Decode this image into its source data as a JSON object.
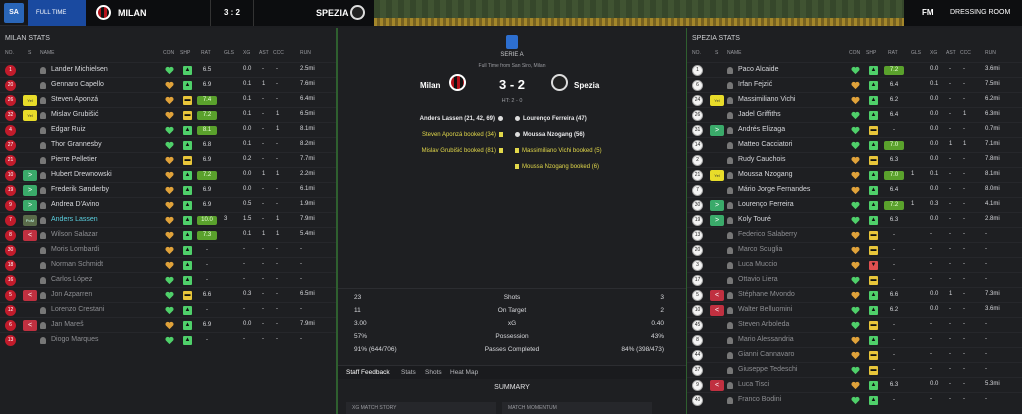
{
  "topbar": {
    "logo": "SA",
    "fulltime": "FULL TIME",
    "home": "MILAN",
    "score": "3 : 2",
    "away": "SPEZIA",
    "fm": "FM",
    "dressing": "DRESSING ROOM",
    "colors": {
      "accent": "#1a4aa0",
      "home": "#b5121b"
    }
  },
  "left": {
    "title": "MILAN STATS",
    "headers": [
      "NO.",
      "S",
      "NAME",
      "CON",
      "SHP",
      "RAT",
      "GLS",
      "XG",
      "AST",
      "CCC",
      "RUN"
    ],
    "players": [
      {
        "no": "1",
        "sub": "",
        "name": "Lander Michielsen",
        "con": "green",
        "shp": "up",
        "rat": "6.5",
        "gls": "",
        "xg": "0.0",
        "ast": "-",
        "ccc": "-",
        "run": "2.5mi",
        "good": false,
        "state": ""
      },
      {
        "no": "20",
        "sub": "",
        "name": "Gennaro Capello",
        "con": "orange",
        "shp": "up",
        "rat": "6.9",
        "gls": "",
        "xg": "0.1",
        "ast": "1",
        "ccc": "-",
        "run": "7.6mi",
        "good": false,
        "state": ""
      },
      {
        "no": "26",
        "sub": "yel",
        "sub_label": "Yel",
        "name": "Steven Aponzá",
        "con": "orange",
        "shp": "mid",
        "rat": "7.4",
        "gls": "",
        "xg": "0.1",
        "ast": "-",
        "ccc": "-",
        "run": "6.4mi",
        "good": true,
        "state": ""
      },
      {
        "no": "32",
        "sub": "yel",
        "sub_label": "Yel",
        "name": "Mislav Grubišić",
        "con": "orange",
        "shp": "mid",
        "rat": "7.2",
        "gls": "",
        "xg": "0.1",
        "ast": "-",
        "ccc": "1",
        "run": "6.5mi",
        "good": true,
        "state": ""
      },
      {
        "no": "4",
        "sub": "",
        "name": "Edgar Ruiz",
        "con": "green",
        "shp": "up",
        "rat": "8.1",
        "gls": "",
        "xg": "0.0",
        "ast": "-",
        "ccc": "1",
        "run": "8.1mi",
        "good": true,
        "state": ""
      },
      {
        "no": "27",
        "sub": "",
        "name": "Thor Grannesby",
        "con": "green",
        "shp": "up",
        "rat": "6.8",
        "gls": "",
        "xg": "0.1",
        "ast": "-",
        "ccc": "-",
        "run": "8.2mi",
        "good": false,
        "state": ""
      },
      {
        "no": "21",
        "sub": "",
        "name": "Pierre Pelletier",
        "con": "orange",
        "shp": "mid",
        "rat": "6.9",
        "gls": "",
        "xg": "0.2",
        "ast": "-",
        "ccc": "-",
        "run": "7.7mi",
        "good": false,
        "state": ""
      },
      {
        "no": "10",
        "sub": "in",
        "sub_label": ">",
        "name": "Hubert Drewnowski",
        "con": "orange",
        "shp": "up",
        "rat": "7.2",
        "gls": "",
        "xg": "0.0",
        "ast": "1",
        "ccc": "1",
        "run": "2.2mi",
        "good": true,
        "state": ""
      },
      {
        "no": "19",
        "sub": "in",
        "sub_label": ">",
        "name": "Frederik Sønderby",
        "con": "orange",
        "shp": "up",
        "rat": "6.9",
        "gls": "",
        "xg": "0.0",
        "ast": "-",
        "ccc": "-",
        "run": "6.1mi",
        "good": false,
        "state": ""
      },
      {
        "no": "9",
        "sub": "in",
        "sub_label": ">",
        "name": "Andrea D'Avino",
        "con": "orange",
        "shp": "up",
        "rat": "6.9",
        "gls": "",
        "xg": "0.5",
        "ast": "-",
        "ccc": "-",
        "run": "1.9mi",
        "good": false,
        "state": ""
      },
      {
        "no": "7",
        "sub": "pom",
        "sub_label": "PoM",
        "name": "Anders Lassen",
        "con": "orange",
        "shp": "up",
        "rat": "10.0",
        "gls": "3",
        "xg": "1.5",
        "ast": "-",
        "ccc": "1",
        "run": "7.9mi",
        "good": true,
        "state": "hl"
      },
      {
        "no": "8",
        "sub": "out",
        "sub_label": "<",
        "name": "Wilson Salazar",
        "con": "orange",
        "shp": "up",
        "rat": "7.3",
        "gls": "",
        "xg": "0.1",
        "ast": "1",
        "ccc": "1",
        "run": "5.4mi",
        "good": true,
        "state": "dim"
      },
      {
        "no": "30",
        "sub": "",
        "name": "Moris Lombardi",
        "con": "orange",
        "shp": "up",
        "rat": "-",
        "gls": "",
        "xg": "-",
        "ast": "-",
        "ccc": "-",
        "run": "-",
        "good": false,
        "state": "dim"
      },
      {
        "no": "18",
        "sub": "",
        "name": "Norman Schmidt",
        "con": "orange",
        "shp": "up",
        "rat": "-",
        "gls": "",
        "xg": "-",
        "ast": "-",
        "ccc": "-",
        "run": "-",
        "good": false,
        "state": "dim"
      },
      {
        "no": "16",
        "sub": "",
        "name": "Carlos López",
        "con": "green",
        "shp": "up",
        "rat": "-",
        "gls": "",
        "xg": "-",
        "ast": "-",
        "ccc": "-",
        "run": "-",
        "good": false,
        "state": "dim"
      },
      {
        "no": "5",
        "sub": "out",
        "sub_label": "<",
        "name": "Jon Azparren",
        "con": "green",
        "shp": "mid",
        "rat": "6.6",
        "gls": "",
        "xg": "0.3",
        "ast": "-",
        "ccc": "-",
        "run": "6.5mi",
        "good": false,
        "state": "dim"
      },
      {
        "no": "12",
        "sub": "",
        "name": "Lorenzo Crestani",
        "con": "green",
        "shp": "up",
        "rat": "-",
        "gls": "",
        "xg": "-",
        "ast": "-",
        "ccc": "-",
        "run": "-",
        "good": false,
        "state": "dim"
      },
      {
        "no": "6",
        "sub": "out",
        "sub_label": "<",
        "name": "Jan Mareš",
        "con": "orange",
        "shp": "up",
        "rat": "6.9",
        "gls": "",
        "xg": "0.0",
        "ast": "-",
        "ccc": "-",
        "run": "7.9mi",
        "good": false,
        "state": "dim"
      },
      {
        "no": "13",
        "sub": "",
        "name": "Diogo Marques",
        "con": "green",
        "shp": "up",
        "rat": "-",
        "gls": "",
        "xg": "-",
        "ast": "-",
        "ccc": "-",
        "run": "-",
        "good": false,
        "state": "dim"
      }
    ]
  },
  "right": {
    "title": "SPEZIA STATS",
    "headers": [
      "NO.",
      "S",
      "NAME",
      "CON",
      "SHP",
      "RAT",
      "GLS",
      "XG",
      "AST",
      "CCC",
      "RUN"
    ],
    "players": [
      {
        "no": "1",
        "sub": "",
        "name": "Paco Alcaide",
        "con": "green",
        "shp": "up",
        "rat": "7.2",
        "gls": "",
        "xg": "0.0",
        "ast": "-",
        "ccc": "-",
        "run": "3.6mi",
        "good": true,
        "state": ""
      },
      {
        "no": "6",
        "sub": "",
        "name": "Irfan Fejzić",
        "con": "orange",
        "shp": "up",
        "rat": "6.4",
        "gls": "",
        "xg": "0.1",
        "ast": "-",
        "ccc": "-",
        "run": "7.5mi",
        "good": false,
        "state": ""
      },
      {
        "no": "24",
        "sub": "yel",
        "sub_label": "Yel",
        "name": "Massimiliano Vichi",
        "con": "orange",
        "shp": "up",
        "rat": "6.2",
        "gls": "",
        "xg": "0.0",
        "ast": "-",
        "ccc": "-",
        "run": "6.2mi",
        "good": false,
        "state": ""
      },
      {
        "no": "26",
        "sub": "",
        "name": "Jadel Griffiths",
        "con": "green",
        "shp": "up",
        "rat": "6.4",
        "gls": "",
        "xg": "0.0",
        "ast": "-",
        "ccc": "1",
        "run": "6.3mi",
        "good": false,
        "state": ""
      },
      {
        "no": "31",
        "sub": "in",
        "sub_label": ">",
        "name": "Andrés Elizaga",
        "con": "green",
        "shp": "mid",
        "rat": "-",
        "gls": "",
        "xg": "0.0",
        "ast": "-",
        "ccc": "-",
        "run": "0.7mi",
        "good": false,
        "state": ""
      },
      {
        "no": "14",
        "sub": "",
        "name": "Matteo Cacciatori",
        "con": "green",
        "shp": "up",
        "rat": "7.0",
        "gls": "",
        "xg": "0.0",
        "ast": "1",
        "ccc": "1",
        "run": "7.1mi",
        "good": true,
        "state": ""
      },
      {
        "no": "2",
        "sub": "",
        "name": "Rudy Cauchois",
        "con": "orange",
        "shp": "mid",
        "rat": "6.3",
        "gls": "",
        "xg": "0.0",
        "ast": "-",
        "ccc": "-",
        "run": "7.8mi",
        "good": false,
        "state": ""
      },
      {
        "no": "21",
        "sub": "yel",
        "sub_label": "Yel",
        "name": "Moussa Nzogang",
        "con": "orange",
        "shp": "up",
        "rat": "7.0",
        "gls": "1",
        "xg": "0.1",
        "ast": "-",
        "ccc": "-",
        "run": "8.1mi",
        "good": true,
        "state": ""
      },
      {
        "no": "7",
        "sub": "",
        "name": "Mário Jorge Fernandes",
        "con": "orange",
        "shp": "up",
        "rat": "6.4",
        "gls": "",
        "xg": "0.0",
        "ast": "-",
        "ccc": "-",
        "run": "8.0mi",
        "good": false,
        "state": ""
      },
      {
        "no": "30",
        "sub": "in",
        "sub_label": ">",
        "name": "Lourenço Ferreira",
        "con": "green",
        "shp": "up",
        "rat": "7.2",
        "gls": "1",
        "xg": "0.3",
        "ast": "-",
        "ccc": "-",
        "run": "4.1mi",
        "good": true,
        "state": ""
      },
      {
        "no": "19",
        "sub": "in",
        "sub_label": ">",
        "name": "Koly Touré",
        "con": "green",
        "shp": "up",
        "rat": "6.3",
        "gls": "",
        "xg": "0.0",
        "ast": "-",
        "ccc": "-",
        "run": "2.8mi",
        "good": false,
        "state": ""
      },
      {
        "no": "13",
        "sub": "",
        "name": "Federico Salaberry",
        "con": "orange",
        "shp": "mid",
        "rat": "-",
        "gls": "",
        "xg": "-",
        "ast": "-",
        "ccc": "-",
        "run": "-",
        "good": false,
        "state": "dim"
      },
      {
        "no": "20",
        "sub": "",
        "name": "Marco Scuglia",
        "con": "orange",
        "shp": "mid",
        "rat": "-",
        "gls": "",
        "xg": "-",
        "ast": "-",
        "ccc": "-",
        "run": "-",
        "good": false,
        "state": "dim"
      },
      {
        "no": "3",
        "sub": "",
        "name": "Luca Muccio",
        "con": "orange",
        "shp": "down",
        "rat": "-",
        "gls": "",
        "xg": "-",
        "ast": "-",
        "ccc": "-",
        "run": "-",
        "good": false,
        "state": "dim"
      },
      {
        "no": "17",
        "sub": "",
        "name": "Ottavio Liera",
        "con": "green",
        "shp": "mid",
        "rat": "-",
        "gls": "",
        "xg": "-",
        "ast": "-",
        "ccc": "-",
        "run": "-",
        "good": false,
        "state": "dim"
      },
      {
        "no": "5",
        "sub": "out",
        "sub_label": "<",
        "name": "Stéphane Mvondo",
        "con": "orange",
        "shp": "up",
        "rat": "6.6",
        "gls": "",
        "xg": "0.0",
        "ast": "1",
        "ccc": "-",
        "run": "7.3mi",
        "good": false,
        "state": "dim"
      },
      {
        "no": "10",
        "sub": "out",
        "sub_label": "<",
        "name": "Walter Belluomini",
        "con": "green",
        "shp": "up",
        "rat": "6.2",
        "gls": "",
        "xg": "0.0",
        "ast": "-",
        "ccc": "-",
        "run": "3.6mi",
        "good": false,
        "state": "dim"
      },
      {
        "no": "45",
        "sub": "",
        "name": "Steven Arboleda",
        "con": "green",
        "shp": "mid",
        "rat": "-",
        "gls": "",
        "xg": "-",
        "ast": "-",
        "ccc": "-",
        "run": "-",
        "good": false,
        "state": "dim"
      },
      {
        "no": "8",
        "sub": "",
        "name": "Mario Alessandria",
        "con": "orange",
        "shp": "up",
        "rat": "-",
        "gls": "",
        "xg": "-",
        "ast": "-",
        "ccc": "-",
        "run": "-",
        "good": false,
        "state": "dim"
      },
      {
        "no": "44",
        "sub": "",
        "name": "Gianni Cannavaro",
        "con": "orange",
        "shp": "mid",
        "rat": "-",
        "gls": "",
        "xg": "-",
        "ast": "-",
        "ccc": "-",
        "run": "-",
        "good": false,
        "state": "dim"
      },
      {
        "no": "37",
        "sub": "",
        "name": "Giuseppe Tedeschi",
        "con": "green",
        "shp": "mid",
        "rat": "-",
        "gls": "",
        "xg": "-",
        "ast": "-",
        "ccc": "-",
        "run": "-",
        "good": false,
        "state": "dim"
      },
      {
        "no": "9",
        "sub": "out",
        "sub_label": "<",
        "name": "Luca Tisci",
        "con": "orange",
        "shp": "up",
        "rat": "6.3",
        "gls": "",
        "xg": "0.0",
        "ast": "-",
        "ccc": "-",
        "run": "5.3mi",
        "good": false,
        "state": "dim"
      },
      {
        "no": "40",
        "sub": "",
        "name": "Franco Bodini",
        "con": "green",
        "shp": "up",
        "rat": "-",
        "gls": "",
        "xg": "-",
        "ast": "-",
        "ccc": "-",
        "run": "-",
        "good": false,
        "state": "dim"
      }
    ]
  },
  "center": {
    "league": "SERIE A",
    "ft": "Full Time from San Siro, Milan",
    "home": "Milan",
    "away": "Spezia",
    "score": "3 - 2",
    "ht": "HT: 2 - 0",
    "events_left": [
      {
        "text": "Anders Lassen (21, 42, 69)",
        "type": "goal"
      },
      {
        "text": "Steven Aponzá booked (34)",
        "type": "card"
      },
      {
        "text": "Mislav Grubišić booked (81)",
        "type": "card"
      }
    ],
    "events_right": [
      {
        "text": "Lourenço Ferreira (47)",
        "type": "goal"
      },
      {
        "text": "Moussa Nzogang (56)",
        "type": "goal"
      },
      {
        "text": "Massimiliano Vichi booked (5)",
        "type": "card"
      },
      {
        "text": "Moussa Nzogang booked (6)",
        "type": "card"
      }
    ],
    "stats": [
      {
        "l": "23",
        "label": "Shots",
        "r": "3"
      },
      {
        "l": "11",
        "label": "On Target",
        "r": "2"
      },
      {
        "l": "3.00",
        "label": "xG",
        "r": "0.40"
      },
      {
        "l": "57%",
        "label": "Possession",
        "r": "43%"
      },
      {
        "l": "91% (644/706)",
        "label": "Passes Completed",
        "r": "84% (398/473)"
      }
    ],
    "tabs": [
      "Staff Feedback",
      "Stats",
      "Shots",
      "Heat Map"
    ],
    "summary": "SUMMARY",
    "bottom": [
      "XG MATCH STORY",
      "MATCH MOMENTUM"
    ]
  }
}
